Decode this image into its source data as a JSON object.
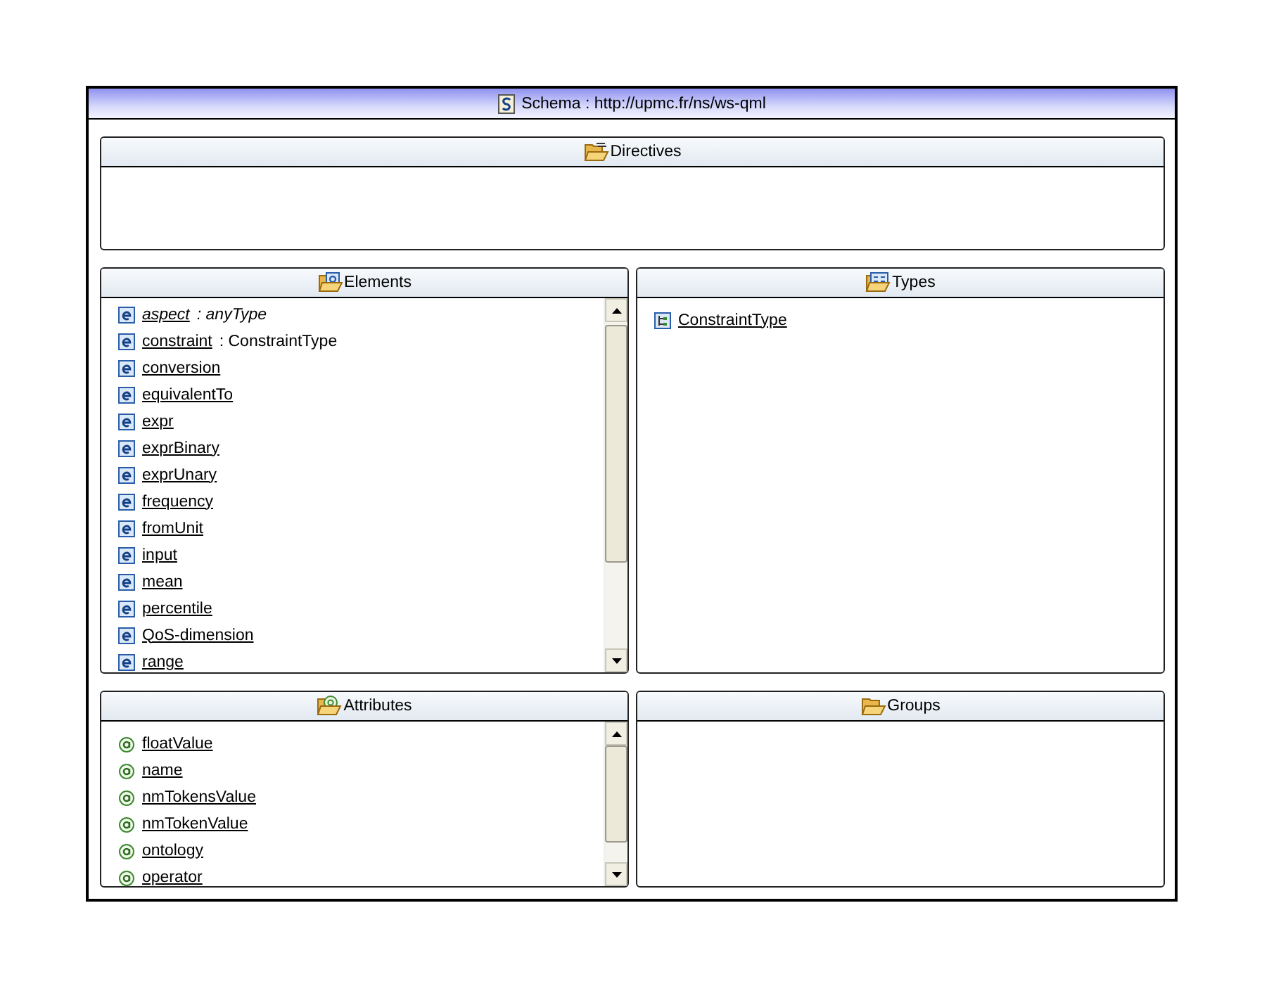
{
  "window": {
    "title": "Schema : http://upmc.fr/ns/ws-qml"
  },
  "panels": [
    {
      "kind": "directives",
      "title": "Directives"
    },
    {
      "kind": "elements",
      "title": "Elements",
      "scrollable": true,
      "items": [
        {
          "name": "aspect",
          "type": ": anyType",
          "italic": true
        },
        {
          "name": "constraint",
          "type": ": ConstraintType",
          "italic": false
        },
        {
          "name": "conversion",
          "italic": false
        },
        {
          "name": "equivalentTo",
          "italic": false
        },
        {
          "name": "expr",
          "italic": false
        },
        {
          "name": "exprBinary",
          "italic": false
        },
        {
          "name": "exprUnary",
          "italic": false
        },
        {
          "name": "frequency",
          "italic": false
        },
        {
          "name": "fromUnit",
          "italic": false
        },
        {
          "name": "input",
          "italic": false
        },
        {
          "name": "mean",
          "italic": false
        },
        {
          "name": "percentile",
          "italic": false
        },
        {
          "name": "QoS-dimension",
          "italic": false
        },
        {
          "name": "range",
          "italic": false
        }
      ]
    },
    {
      "kind": "types",
      "title": "Types",
      "items": [
        {
          "name": "ConstraintType",
          "italic": false
        }
      ]
    },
    {
      "kind": "attributes",
      "title": "Attributes",
      "scrollable": true,
      "items": [
        {
          "name": "floatValue",
          "italic": false
        },
        {
          "name": "name",
          "italic": false
        },
        {
          "name": "nmTokensValue",
          "italic": false
        },
        {
          "name": "nmTokenValue",
          "italic": false
        },
        {
          "name": "ontology",
          "italic": false
        },
        {
          "name": "operator",
          "italic": false
        }
      ]
    },
    {
      "kind": "groups",
      "title": "Groups"
    }
  ]
}
